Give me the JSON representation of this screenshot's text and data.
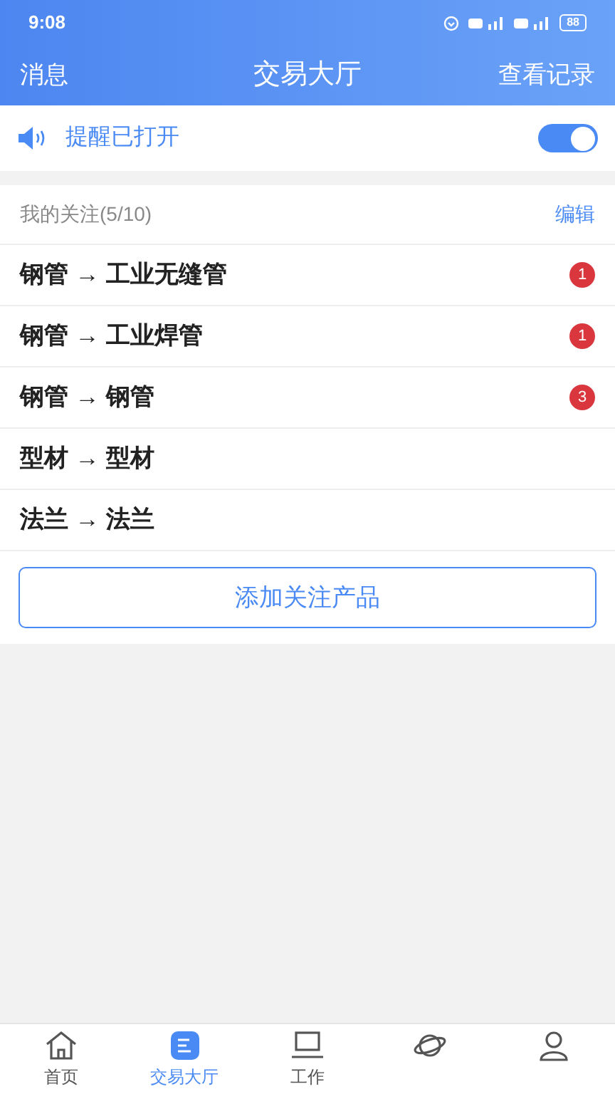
{
  "status_bar": {
    "time": "9:08",
    "battery": "88"
  },
  "header": {
    "left": "消息",
    "title": "交易大厅",
    "right": "查看记录"
  },
  "alert": {
    "label": "提醒已打开",
    "on": true
  },
  "watchlist": {
    "title": "我的关注(5/10)",
    "edit": "编辑",
    "items": [
      {
        "label": "钢管 → 工业无缝管",
        "count": "1"
      },
      {
        "label": "钢管 → 工业焊管",
        "count": "1"
      },
      {
        "label": "钢管 → 钢管",
        "count": "3"
      },
      {
        "label": "型材 → 型材"
      },
      {
        "label": "法兰 → 法兰"
      }
    ],
    "add_button": "添加关注产品"
  },
  "tabs": [
    {
      "kind": "home",
      "label": "首页",
      "selected": false
    },
    {
      "kind": "hall",
      "label": "交易大厅",
      "selected": true
    },
    {
      "kind": "desk",
      "label": "工作",
      "selected": false
    },
    {
      "kind": "planet",
      "selected": false
    },
    {
      "kind": "user",
      "selected": false
    }
  ]
}
